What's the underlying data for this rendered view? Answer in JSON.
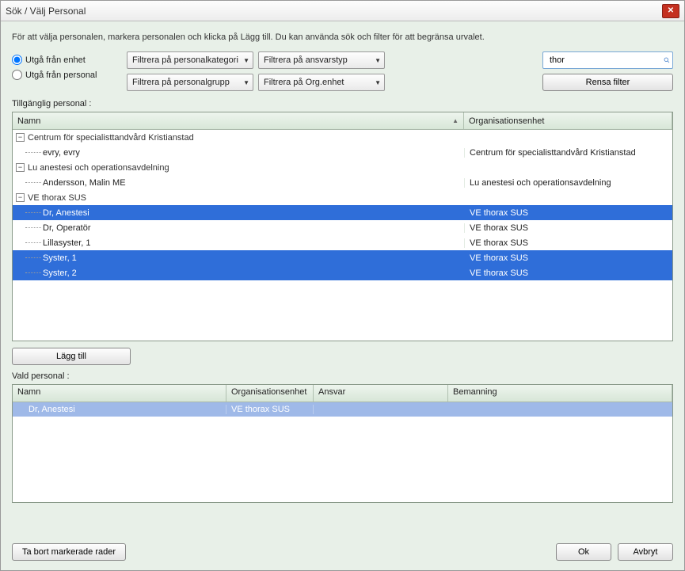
{
  "window": {
    "title": "Sök / Välj Personal"
  },
  "description": "För att välja personalen, markera personalen och klicka på Lägg till. Du kan använda sök och filter för att begränsa urvalet.",
  "radios": {
    "from_unit": "Utgå från enhet",
    "from_person": "Utgå från personal",
    "selected": "from_unit"
  },
  "filters": {
    "category": "Filtrera på personalkategori",
    "responsibility": "Filtrera på ansvarstyp",
    "group": "Filtrera på personalgrupp",
    "orgunit": "Filtrera på Org.enhet"
  },
  "search": {
    "value": "thor"
  },
  "clear_filter": "Rensa filter",
  "available_label": "Tillgänglig personal :",
  "tree_headers": {
    "name": "Namn",
    "org": "Organisationsenhet"
  },
  "tree": [
    {
      "type": "group",
      "label": "Centrum för specialisttandvård Kristianstad"
    },
    {
      "type": "leaf",
      "label": "evry, evry",
      "org": "Centrum för specialisttandvård Kristianstad",
      "selected": false
    },
    {
      "type": "group",
      "label": "Lu anestesi och operationsavdelning"
    },
    {
      "type": "leaf",
      "label": "Andersson, Malin ME",
      "org": "Lu anestesi och operationsavdelning",
      "selected": false
    },
    {
      "type": "group",
      "label": "VE thorax SUS"
    },
    {
      "type": "leaf",
      "label": "Dr, Anestesi",
      "org": "VE thorax SUS",
      "selected": true
    },
    {
      "type": "leaf",
      "label": "Dr, Operatör",
      "org": "VE thorax SUS",
      "selected": false
    },
    {
      "type": "leaf",
      "label": "Lillasyster, 1",
      "org": "VE thorax SUS",
      "selected": false
    },
    {
      "type": "leaf",
      "label": "Syster, 1",
      "org": "VE thorax SUS",
      "selected": true
    },
    {
      "type": "leaf",
      "label": "Syster, 2",
      "org": "VE thorax SUS",
      "selected": true
    }
  ],
  "add_button": "Lägg till",
  "selected_label": "Vald personal :",
  "sel_headers": {
    "name": "Namn",
    "org": "Organisationsenhet",
    "resp": "Ansvar",
    "staffing": "Bemanning"
  },
  "selected_rows": [
    {
      "name": "Dr, Anestesi",
      "org": "VE thorax SUS",
      "resp": "",
      "staffing": ""
    }
  ],
  "remove_button": "Ta bort markerade rader",
  "ok": "Ok",
  "cancel": "Avbryt"
}
